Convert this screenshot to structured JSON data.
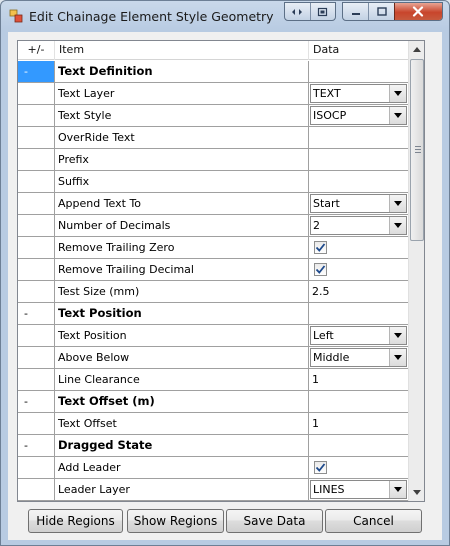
{
  "window": {
    "title": "Edit Chainage Element Style Geometry"
  },
  "grid": {
    "columns": [
      "+/-",
      "Item",
      "Data"
    ],
    "rows": [
      {
        "type": "section",
        "sign": "-",
        "item": "Text Definition"
      },
      {
        "type": "combo",
        "item": "Text Layer",
        "value": "TEXT"
      },
      {
        "type": "combo",
        "item": "Text Style",
        "value": "ISOCP"
      },
      {
        "type": "text",
        "item": "OverRide Text",
        "value": ""
      },
      {
        "type": "text",
        "item": "Prefix",
        "value": ""
      },
      {
        "type": "text",
        "item": "Suffix",
        "value": ""
      },
      {
        "type": "combo",
        "item": "Append Text To",
        "value": "Start"
      },
      {
        "type": "combo",
        "item": "Number of Decimals",
        "value": "2"
      },
      {
        "type": "check",
        "item": "Remove Trailing Zero",
        "checked": true
      },
      {
        "type": "check",
        "item": "Remove Trailing Decimal",
        "checked": true
      },
      {
        "type": "text",
        "item": "Test Size (mm)",
        "value": "2.5"
      },
      {
        "type": "section",
        "sign": "-",
        "item": "Text Position"
      },
      {
        "type": "combo",
        "item": "Text Position",
        "value": "Left"
      },
      {
        "type": "combo",
        "item": "Above Below",
        "value": "Middle"
      },
      {
        "type": "text",
        "item": "Line Clearance",
        "value": "1"
      },
      {
        "type": "section",
        "sign": "-",
        "item": "Text Offset (m)"
      },
      {
        "type": "text",
        "item": "Text Offset",
        "value": "1"
      },
      {
        "type": "section",
        "sign": "-",
        "item": "Dragged State"
      },
      {
        "type": "check",
        "item": "Add Leader",
        "checked": true
      },
      {
        "type": "combo",
        "item": "Leader Layer",
        "value": "LINES"
      }
    ]
  },
  "buttons": {
    "hide_regions": "Hide Regions",
    "show_regions": "Show Regions",
    "save_data": "Save Data",
    "cancel": "Cancel"
  },
  "colors": {
    "selection": "#3399ff",
    "close_button": "#c8452c"
  }
}
